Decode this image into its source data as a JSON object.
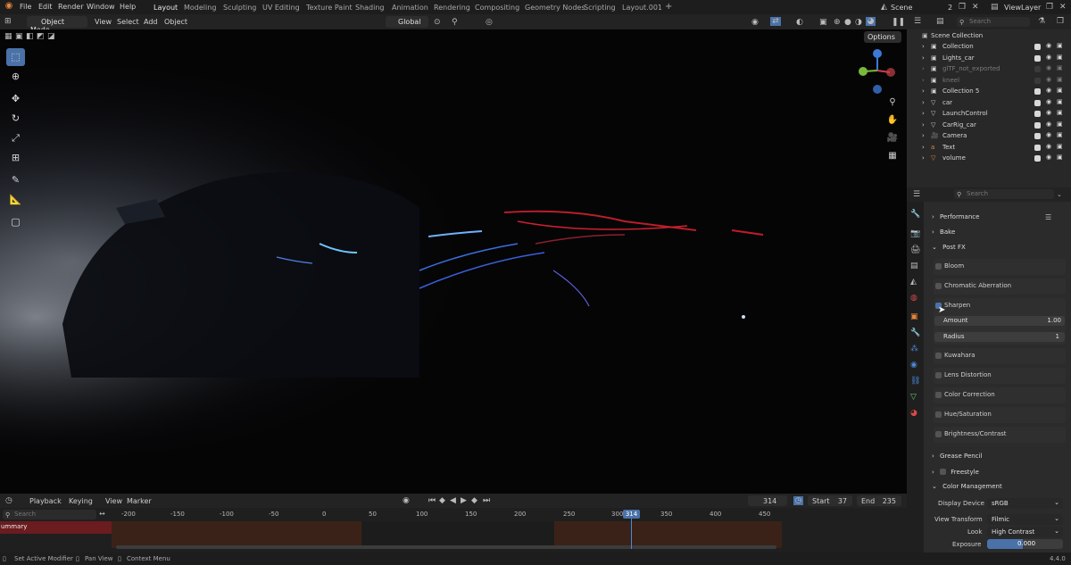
{
  "topbar": {
    "menus": [
      "File",
      "Edit",
      "Render",
      "Window",
      "Help"
    ],
    "workspaces": [
      "Layout",
      "Modeling",
      "Sculpting",
      "UV Editing",
      "Texture Paint",
      "Shading",
      "Animation",
      "Rendering",
      "Compositing",
      "Geometry Nodes",
      "Scripting",
      "Layout.001"
    ],
    "active_workspace": "Layout",
    "add_workspace": "+",
    "scene": "Scene",
    "scene_users": "2",
    "view_layer": "ViewLayer"
  },
  "viewport_header": {
    "mode": "Object Mode",
    "menus": [
      "View",
      "Select",
      "Add",
      "Object"
    ],
    "transform_orientation": "Global",
    "options_label": "Options"
  },
  "outliner": {
    "search_placeholder": "Search",
    "root": "Scene Collection",
    "items": [
      {
        "name": "Collection",
        "dim": false
      },
      {
        "name": "Lights_car",
        "dim": false
      },
      {
        "name": "glTF_not_exported",
        "dim": true
      },
      {
        "name": "kneel",
        "dim": true
      },
      {
        "name": "Collection 5",
        "dim": false
      },
      {
        "name": "car",
        "dim": false
      },
      {
        "name": "LaunchControl",
        "dim": false
      },
      {
        "name": "CarRig_car",
        "dim": false
      },
      {
        "name": "Camera",
        "dim": false
      },
      {
        "name": "Text",
        "dim": false
      },
      {
        "name": "volume",
        "dim": false
      }
    ]
  },
  "properties": {
    "search_placeholder": "Search",
    "panels": {
      "performance": "Performance",
      "bake": "Bake",
      "post_fx": "Post FX",
      "bloom": "Bloom",
      "chromatic": "Chromatic Aberration",
      "sharpen": "Sharpen",
      "amount_label": "Amount",
      "amount_value": "1.00",
      "radius_label": "Radius",
      "radius_value": "1",
      "kuwahara": "Kuwahara",
      "lens": "Lens Distortion",
      "color_correction": "Color Correction",
      "hue": "Hue/Saturation",
      "brightness": "Brightness/Contrast",
      "grease_pencil": "Grease Pencil",
      "freestyle": "Freestyle",
      "color_management": "Color Management",
      "display_device_label": "Display Device",
      "display_device_value": "sRGB",
      "view_transform_label": "View Transform",
      "view_transform_value": "Filmic",
      "look_label": "Look",
      "look_value": "High Contrast",
      "exposure_label": "Exposure",
      "exposure_value": "0.000"
    }
  },
  "timeline": {
    "menus": [
      "Playback",
      "Keying",
      "View",
      "Marker"
    ],
    "current_frame": "314",
    "start_label": "Start",
    "start_value": "37",
    "end_label": "End",
    "end_value": "235",
    "search_placeholder": "Search",
    "ticks": [
      "-200",
      "-150",
      "-100",
      "-50",
      "0",
      "50",
      "100",
      "150",
      "200",
      "250",
      "300",
      "350",
      "400",
      "450"
    ],
    "playhead_label": "314",
    "track_label": "ummary"
  },
  "statusbar": {
    "items": [
      "Set Active Modifier",
      "Pan View",
      "Context Menu"
    ],
    "version": "4.4.0"
  },
  "colors": {
    "accent": "#4a72a8",
    "orange": "#e8873a",
    "bg": "#1d1d1d"
  }
}
